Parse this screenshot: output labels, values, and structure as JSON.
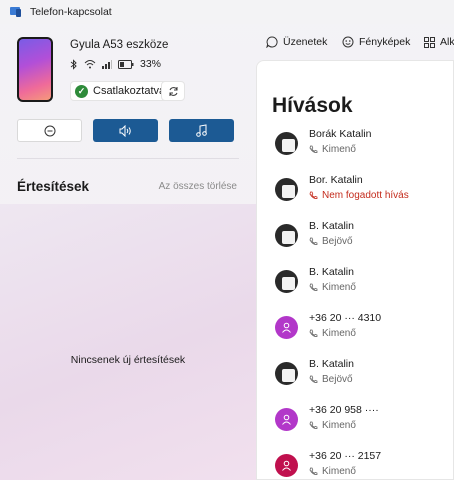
{
  "window": {
    "title": "Telefon-kapcsolat"
  },
  "device": {
    "name": "Gyula A53 eszköze",
    "battery": "33%",
    "connection_label": "Csatlakoztatva"
  },
  "notifications": {
    "title": "Értesítések",
    "clear_all": "Az összes törlése",
    "empty_text": "Nincsenek új értesítések"
  },
  "nav": [
    {
      "label": "Üzenetek",
      "icon": "message-icon"
    },
    {
      "label": "Fényképek",
      "icon": "photo-icon"
    },
    {
      "label": "Alk",
      "icon": "apps-icon"
    }
  ],
  "calls": {
    "title": "Hívások",
    "items": [
      {
        "name": "Borák Katalin",
        "type": "Kimenő",
        "avatar": "photo"
      },
      {
        "name": "Bor. Katalin",
        "type": "Nem fogadott hívás",
        "avatar": "photo",
        "missed": true
      },
      {
        "name": "B. Katalin",
        "type": "Bejövő",
        "avatar": "photo"
      },
      {
        "name": "B. Katalin",
        "type": "Kimenő",
        "avatar": "photo"
      },
      {
        "name": "+36 20 ··· 4310",
        "type": "Kimenő",
        "avatar": "purple"
      },
      {
        "name": "B. Katalin",
        "type": "Bejövő",
        "avatar": "photo"
      },
      {
        "name": "+36 20 958 ····",
        "type": "Kimenő",
        "avatar": "purple"
      },
      {
        "name": "+36 20 ··· 2157",
        "type": "Kimenő",
        "avatar": "crimson"
      }
    ]
  },
  "colors": {
    "accent": "#1c5a94",
    "connected": "#2e8b3a",
    "missed": "#c42b1c",
    "avatar_purple": "#b237c9",
    "avatar_crimson": "#c0104e"
  }
}
